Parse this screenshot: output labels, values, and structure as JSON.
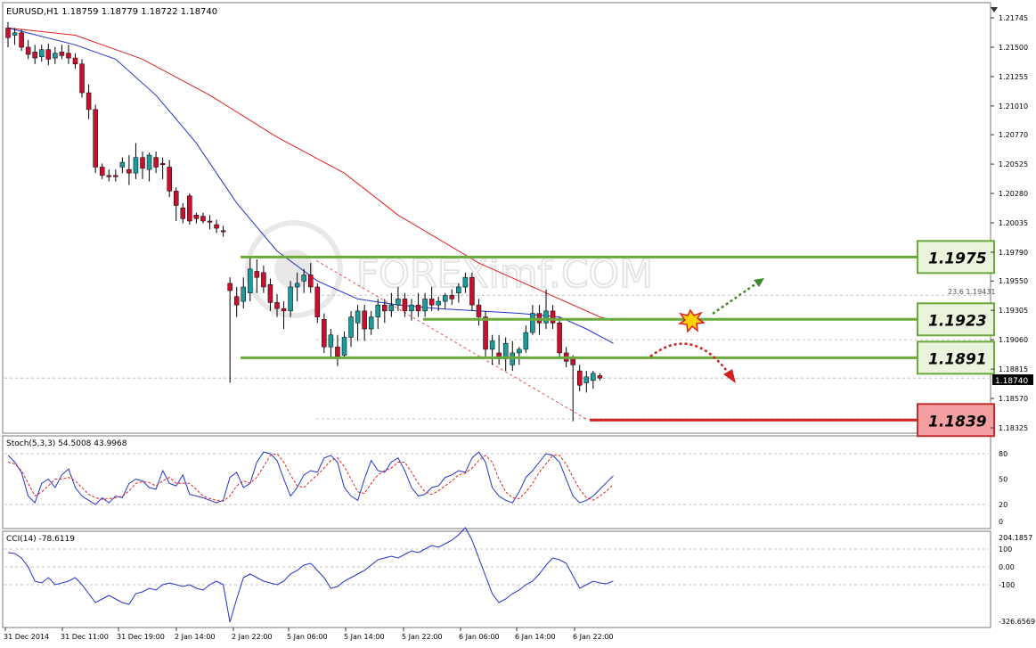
{
  "chart_data": {
    "type": "candlestick",
    "symbol_header": "EURUSD,H1  1.18759 1.18779 1.18722 1.18740",
    "current_price": "1.18740",
    "watermark": "FOREXimf.COM",
    "y_ticks": [
      "1.21745",
      "1.21500",
      "1.21255",
      "1.21010",
      "1.20770",
      "1.20525",
      "1.20280",
      "1.20035",
      "1.19790",
      "1.19550",
      "1.19305",
      "1.19060",
      "1.18815",
      "1.18570",
      "1.18325"
    ],
    "x_ticks": [
      "31 Dec 2014",
      "31 Dec 11:00",
      "31 Dec 19:00",
      "2 Jan 14:00",
      "2 Jan 22:00",
      "5 Jan 06:00",
      "5 Jan 14:00",
      "5 Jan 22:00",
      "6 Jan 06:00",
      "6 Jan 14:00",
      "6 Jan 22:00"
    ],
    "fib_label": "23.6 1.19431",
    "levels": [
      {
        "label": "1.1975",
        "value": 1.1975,
        "color": "#6aaa3a"
      },
      {
        "label": "1.1923",
        "value": 1.1923,
        "color": "#6aaa3a"
      },
      {
        "label": "1.1891",
        "value": 1.1891,
        "color": "#6aaa3a"
      },
      {
        "label": "1.1839",
        "value": 1.1839,
        "color": "#d02020"
      }
    ],
    "ohlc": [
      [
        1.2166,
        1.2171,
        1.215,
        1.2158
      ],
      [
        1.216,
        1.2166,
        1.2152,
        1.2162
      ],
      [
        1.2162,
        1.2165,
        1.2147,
        1.215
      ],
      [
        1.215,
        1.2156,
        1.214,
        1.2144
      ],
      [
        1.2146,
        1.2152,
        1.2136,
        1.2141
      ],
      [
        1.2142,
        1.2152,
        1.2138,
        1.2148
      ],
      [
        1.2148,
        1.2153,
        1.2135,
        1.214
      ],
      [
        1.2141,
        1.215,
        1.2136,
        1.2145
      ],
      [
        1.2146,
        1.2152,
        1.214,
        1.2143
      ],
      [
        1.2145,
        1.2152,
        1.2136,
        1.2141
      ],
      [
        1.2141,
        1.2145,
        1.2132,
        1.2136
      ],
      [
        1.2136,
        1.214,
        1.2108,
        1.2112
      ],
      [
        1.2112,
        1.2119,
        1.209,
        1.2098
      ],
      [
        1.2098,
        1.2102,
        1.2045,
        1.205
      ],
      [
        1.205,
        1.2053,
        1.204,
        1.2043
      ],
      [
        1.2043,
        1.2048,
        1.2038,
        1.2042
      ],
      [
        1.2043,
        1.2048,
        1.2038,
        1.2042
      ],
      [
        1.205,
        1.2058,
        1.2045,
        1.2054
      ],
      [
        1.2048,
        1.206,
        1.2035,
        1.2045
      ],
      [
        1.2045,
        1.207,
        1.204,
        1.2058
      ],
      [
        1.2058,
        1.2063,
        1.204,
        1.2049
      ],
      [
        1.2048,
        1.2062,
        1.2038,
        1.206
      ],
      [
        1.2058,
        1.2063,
        1.2045,
        1.205
      ],
      [
        1.2053,
        1.2058,
        1.204,
        1.2052
      ],
      [
        1.205,
        1.2056,
        1.2025,
        1.203
      ],
      [
        1.203,
        1.2033,
        1.2005,
        1.2018
      ],
      [
        1.2016,
        1.202,
        1.2003,
        1.2007
      ],
      [
        1.2026,
        1.2028,
        1.2002,
        1.2005
      ],
      [
        1.201,
        1.2012,
        1.2003,
        1.2007
      ],
      [
        1.2009,
        1.2012,
        1.2003,
        1.2005
      ],
      [
        1.2005,
        1.201,
        1.1998,
        1.2004
      ],
      [
        1.2002,
        1.2006,
        1.1995,
        1.1999
      ],
      [
        1.1997,
        1.2001,
        1.1992,
        1.1996
      ],
      [
        1.1953,
        1.1958,
        1.187,
        1.1947
      ],
      [
        1.1942,
        1.195,
        1.1925,
        1.1935
      ],
      [
        1.1938,
        1.1958,
        1.1932,
        1.195
      ],
      [
        1.1945,
        1.1975,
        1.1938,
        1.1965
      ],
      [
        1.1963,
        1.1973,
        1.1945,
        1.1958
      ],
      [
        1.1962,
        1.1968,
        1.1945,
        1.195
      ],
      [
        1.1952,
        1.1957,
        1.193,
        1.1937
      ],
      [
        1.1937,
        1.1944,
        1.1925,
        1.1932
      ],
      [
        1.1932,
        1.1938,
        1.1915,
        1.193
      ],
      [
        1.193,
        1.1955,
        1.1925,
        1.195
      ],
      [
        1.195,
        1.1962,
        1.1938,
        1.1953
      ],
      [
        1.1955,
        1.1965,
        1.1945,
        1.196
      ],
      [
        1.196,
        1.197,
        1.1945,
        1.195
      ],
      [
        1.195,
        1.1953,
        1.192,
        1.1925
      ],
      [
        1.1923,
        1.1928,
        1.1895,
        1.19
      ],
      [
        1.19,
        1.1915,
        1.189,
        1.191
      ],
      [
        1.19,
        1.191,
        1.1884,
        1.1892
      ],
      [
        1.1893,
        1.1913,
        1.189,
        1.1908
      ],
      [
        1.1908,
        1.193,
        1.19,
        1.1925
      ],
      [
        1.192,
        1.1935,
        1.1905,
        1.193
      ],
      [
        1.193,
        1.1935,
        1.1905,
        1.1915
      ],
      [
        1.1915,
        1.193,
        1.191,
        1.1925
      ],
      [
        1.1925,
        1.194,
        1.1915,
        1.1935
      ],
      [
        1.1935,
        1.194,
        1.192,
        1.193
      ],
      [
        1.193,
        1.1945,
        1.1925,
        1.1935
      ],
      [
        1.1935,
        1.195,
        1.193,
        1.194
      ],
      [
        1.194,
        1.1945,
        1.1925,
        1.193
      ],
      [
        1.193,
        1.194,
        1.1922,
        1.1935
      ],
      [
        1.1935,
        1.1945,
        1.1925,
        1.193
      ],
      [
        1.193,
        1.1945,
        1.1925,
        1.194
      ],
      [
        1.194,
        1.195,
        1.193,
        1.1935
      ],
      [
        1.1935,
        1.1942,
        1.193,
        1.1938
      ],
      [
        1.1938,
        1.1945,
        1.1932,
        1.1943
      ],
      [
        1.1943,
        1.1948,
        1.1935,
        1.194
      ],
      [
        1.1945,
        1.1953,
        1.1937,
        1.195
      ],
      [
        1.195,
        1.1962,
        1.1945,
        1.1958
      ],
      [
        1.1958,
        1.1962,
        1.193,
        1.1935
      ],
      [
        1.1935,
        1.194,
        1.1918,
        1.1925
      ],
      [
        1.1925,
        1.193,
        1.1892,
        1.1898
      ],
      [
        1.1898,
        1.191,
        1.1885,
        1.1905
      ],
      [
        1.1895,
        1.191,
        1.1885,
        1.189
      ],
      [
        1.189,
        1.1908,
        1.188,
        1.1903
      ],
      [
        1.1885,
        1.1905,
        1.188,
        1.1895
      ],
      [
        1.1895,
        1.19,
        1.1885,
        1.1898
      ],
      [
        1.1898,
        1.1918,
        1.1895,
        1.1912
      ],
      [
        1.1912,
        1.1935,
        1.191,
        1.1928
      ],
      [
        1.1928,
        1.1935,
        1.191,
        1.192
      ],
      [
        1.192,
        1.1948,
        1.1915,
        1.193
      ],
      [
        1.193,
        1.1935,
        1.1915,
        1.192
      ],
      [
        1.192,
        1.1925,
        1.189,
        1.1895
      ],
      [
        1.1895,
        1.19,
        1.1883,
        1.1888
      ],
      [
        1.189,
        1.1893,
        1.1838,
        1.1885
      ],
      [
        1.188,
        1.1885,
        1.1863,
        1.1868
      ],
      [
        1.187,
        1.188,
        1.1862,
        1.1875
      ],
      [
        1.1872,
        1.188,
        1.1865,
        1.1878
      ],
      [
        1.1876,
        1.1878,
        1.1872,
        1.1874
      ]
    ],
    "ma_fast": [
      [
        0,
        1.2166
      ],
      [
        10,
        1.2152
      ],
      [
        16,
        1.214
      ],
      [
        22,
        1.211
      ],
      [
        28,
        1.207
      ],
      [
        34,
        1.202
      ],
      [
        40,
        1.198
      ],
      [
        46,
        1.1955
      ],
      [
        52,
        1.194
      ],
      [
        58,
        1.1935
      ],
      [
        64,
        1.1932
      ],
      [
        70,
        1.193
      ],
      [
        76,
        1.1928
      ],
      [
        82,
        1.1925
      ],
      [
        86,
        1.1915
      ],
      [
        90,
        1.1903
      ]
    ],
    "ma_slow": [
      [
        0,
        1.2166
      ],
      [
        10,
        1.216
      ],
      [
        20,
        1.214
      ],
      [
        30,
        1.211
      ],
      [
        40,
        1.2075
      ],
      [
        50,
        1.2045
      ],
      [
        58,
        1.201
      ],
      [
        64,
        1.199
      ],
      [
        70,
        1.197
      ],
      [
        76,
        1.1955
      ],
      [
        82,
        1.194
      ],
      [
        88,
        1.1925
      ],
      [
        90,
        1.1922
      ]
    ],
    "stoch": {
      "header": "Stoch(5,3,3) 54.5008 43.9968",
      "y_ticks": [
        "80",
        "50",
        "20",
        "0"
      ],
      "k": [
        78,
        70,
        58,
        30,
        22,
        45,
        50,
        40,
        55,
        62,
        40,
        30,
        25,
        20,
        28,
        22,
        30,
        28,
        45,
        50,
        48,
        40,
        38,
        60,
        45,
        42,
        55,
        32,
        30,
        28,
        25,
        22,
        25,
        52,
        58,
        40,
        45,
        70,
        82,
        80,
        72,
        50,
        30,
        40,
        55,
        60,
        58,
        75,
        78,
        70,
        40,
        30,
        25,
        50,
        72,
        60,
        58,
        70,
        75,
        60,
        40,
        30,
        32,
        40,
        42,
        52,
        55,
        60,
        58,
        75,
        82,
        70,
        40,
        30,
        25,
        22,
        35,
        52,
        60,
        70,
        80,
        78,
        70,
        50,
        30,
        22,
        25,
        30,
        38,
        46,
        54
      ],
      "d": [
        70,
        68,
        60,
        45,
        30,
        35,
        42,
        50,
        50,
        52,
        48,
        40,
        32,
        28,
        26,
        27,
        28,
        30,
        36,
        45,
        47,
        46,
        42,
        48,
        52,
        45,
        45,
        45,
        38,
        30,
        27,
        25,
        24,
        30,
        42,
        48,
        45,
        52,
        65,
        78,
        80,
        70,
        55,
        42,
        40,
        48,
        55,
        63,
        72,
        75,
        65,
        50,
        35,
        33,
        45,
        55,
        60,
        63,
        70,
        70,
        58,
        45,
        35,
        32,
        36,
        42,
        48,
        55,
        57,
        63,
        72,
        78,
        70,
        50,
        35,
        28,
        27,
        35,
        45,
        58,
        68,
        78,
        78,
        68,
        52,
        38,
        28,
        25,
        30,
        36,
        44
      ]
    },
    "cci": {
      "header": "CCI(14) -78.6119",
      "y_ticks": [
        "204.1857",
        "100",
        "0.00",
        "-100",
        "-326.6569"
      ],
      "values": [
        80,
        75,
        50,
        0,
        -80,
        -90,
        -60,
        -100,
        -90,
        -80,
        -60,
        -100,
        -150,
        -200,
        -180,
        -160,
        -180,
        -200,
        -210,
        -150,
        -140,
        -120,
        -130,
        -100,
        -90,
        -100,
        -110,
        -100,
        -120,
        -130,
        -100,
        -80,
        -100,
        -310,
        -180,
        -60,
        -40,
        -60,
        -80,
        -90,
        -100,
        -80,
        -40,
        -20,
        10,
        20,
        -20,
        -60,
        -120,
        -110,
        -80,
        -60,
        -40,
        -20,
        10,
        40,
        50,
        60,
        50,
        70,
        90,
        80,
        100,
        120,
        110,
        130,
        150,
        180,
        220,
        150,
        50,
        -50,
        -150,
        -200,
        -180,
        -150,
        -130,
        -100,
        -80,
        -40,
        10,
        50,
        40,
        20,
        -50,
        -120,
        -100,
        -80,
        -90,
        -95,
        -79
      ]
    }
  }
}
